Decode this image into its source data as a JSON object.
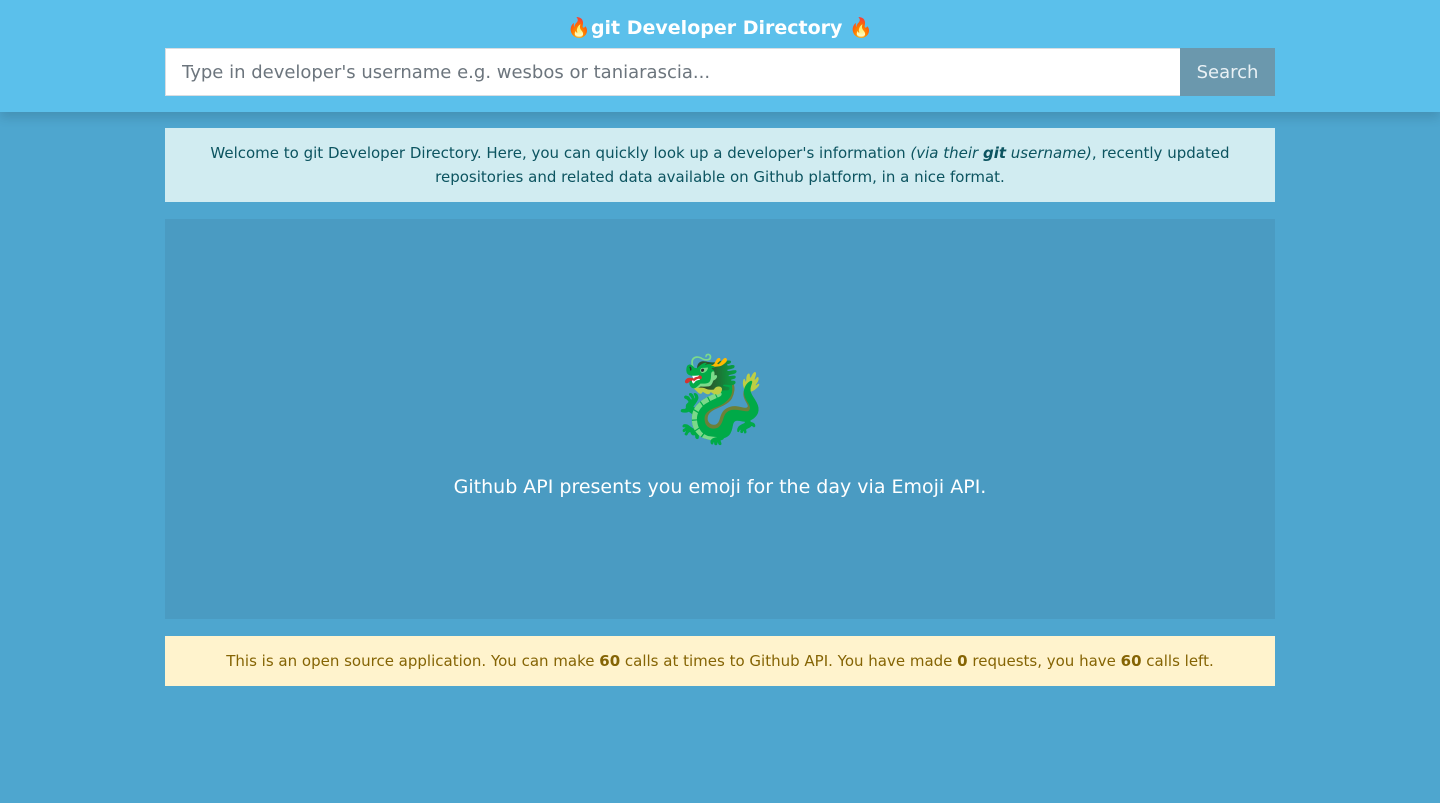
{
  "header": {
    "title_prefix_icon": "🔥",
    "title": "git Developer Directory",
    "title_suffix_icon": "🔥",
    "background_color": "#5bc0eb"
  },
  "search": {
    "placeholder": "Type in developer's username e.g. wesbos or taniarascia...",
    "value": "",
    "button_label": "Search"
  },
  "info": {
    "text_before": "Welcome to git Developer Directory. Here, you can quickly look up a developer's information ",
    "italic_before": "(via their ",
    "bold_italic": "git",
    "italic_after": " username)",
    "text_after": ", recently updated repositories and related data available on Github platform, in a nice format."
  },
  "emoji_panel": {
    "emoji": "🐉",
    "emoji_name": "dragon-face",
    "caption": "Github API presents you emoji for the day via Emoji API."
  },
  "rate_limit": {
    "text1": "This is an open source application. You can make ",
    "limit": "60",
    "text2": " calls at times to Github API. You have made ",
    "made": "0",
    "text3": " requests, you have ",
    "left": "60",
    "text4": " calls left."
  },
  "colors": {
    "page_background": "#4ea6cf",
    "info_background": "#d1ecf1",
    "warning_background": "#fff3cd",
    "button_background": "#6b98ad"
  }
}
